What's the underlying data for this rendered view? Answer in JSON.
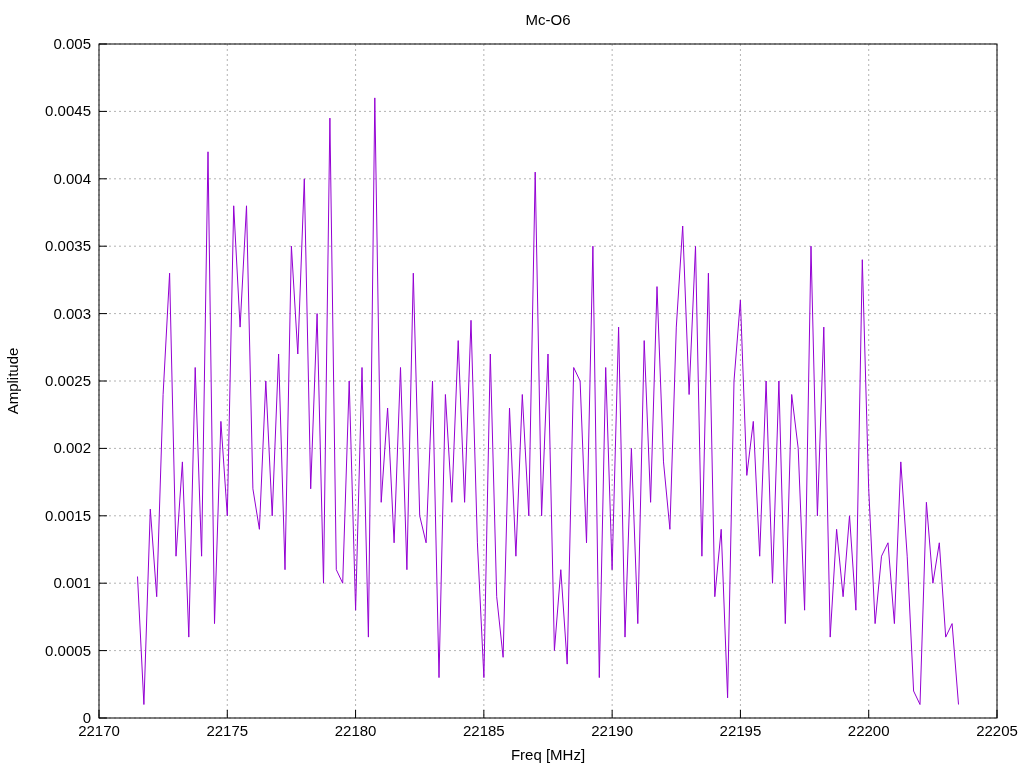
{
  "chart_data": {
    "type": "line",
    "title": "Mc-O6",
    "xlabel": "Freq [MHz]",
    "ylabel": "Amplitude",
    "xlim": [
      22170,
      22205
    ],
    "ylim": [
      0,
      0.005
    ],
    "xticks": [
      22170,
      22175,
      22180,
      22185,
      22190,
      22195,
      22200,
      22205
    ],
    "yticks": [
      0,
      0.0005,
      0.001,
      0.0015,
      0.002,
      0.0025,
      0.003,
      0.0035,
      0.004,
      0.0045,
      0.005
    ],
    "x": [
      22171.5,
      22171.75,
      22172,
      22172.25,
      22172.5,
      22172.75,
      22173,
      22173.25,
      22173.5,
      22173.75,
      22174,
      22174.25,
      22174.5,
      22174.75,
      22175,
      22175.25,
      22175.5,
      22175.75,
      22176,
      22176.25,
      22176.5,
      22176.75,
      22177,
      22177.25,
      22177.5,
      22177.75,
      22178,
      22178.25,
      22178.5,
      22178.75,
      22179,
      22179.25,
      22179.5,
      22179.75,
      22180,
      22180.25,
      22180.5,
      22180.75,
      22181,
      22181.25,
      22181.5,
      22181.75,
      22182,
      22182.25,
      22182.5,
      22182.75,
      22183,
      22183.25,
      22183.5,
      22183.75,
      22184,
      22184.25,
      22184.5,
      22184.75,
      22185,
      22185.25,
      22185.5,
      22185.75,
      22186,
      22186.25,
      22186.5,
      22186.75,
      22187,
      22187.25,
      22187.5,
      22187.75,
      22188,
      22188.25,
      22188.5,
      22188.75,
      22189,
      22189.25,
      22189.5,
      22189.75,
      22190,
      22190.25,
      22190.5,
      22190.75,
      22191,
      22191.25,
      22191.5,
      22191.75,
      22192,
      22192.25,
      22192.5,
      22192.75,
      22193,
      22193.25,
      22193.5,
      22193.75,
      22194,
      22194.25,
      22194.5,
      22194.75,
      22195,
      22195.25,
      22195.5,
      22195.75,
      22196,
      22196.25,
      22196.5,
      22196.75,
      22197,
      22197.25,
      22197.5,
      22197.75,
      22198,
      22198.25,
      22198.5,
      22198.75,
      22199,
      22199.25,
      22199.5,
      22199.75,
      22200,
      22200.25,
      22200.5,
      22200.75,
      22201,
      22201.25,
      22201.5,
      22201.75,
      22202,
      22202.25,
      22202.5,
      22202.75,
      22203,
      22203.25,
      22203.5
    ],
    "grid": true,
    "series": [
      {
        "color": "#9400d3",
        "values": [
          0.00105,
          0.0001,
          0.00155,
          0.0009,
          0.0024,
          0.0033,
          0.0012,
          0.0019,
          0.0006,
          0.0026,
          0.0012,
          0.0042,
          0.0007,
          0.0022,
          0.0015,
          0.0038,
          0.0029,
          0.0038,
          0.0017,
          0.0014,
          0.0025,
          0.0015,
          0.0027,
          0.0011,
          0.0035,
          0.0027,
          0.004,
          0.0017,
          0.003,
          0.001,
          0.00445,
          0.0011,
          0.001,
          0.0025,
          0.0008,
          0.0026,
          0.0006,
          0.0046,
          0.0016,
          0.0023,
          0.0013,
          0.0026,
          0.0011,
          0.0033,
          0.0015,
          0.0013,
          0.0025,
          0.0003,
          0.0024,
          0.0016,
          0.0028,
          0.0016,
          0.00295,
          0.0013,
          0.0003,
          0.0027,
          0.0009,
          0.00045,
          0.0023,
          0.0012,
          0.0024,
          0.0015,
          0.00405,
          0.0015,
          0.0027,
          0.0005,
          0.0011,
          0.0004,
          0.0026,
          0.0025,
          0.0013,
          0.0035,
          0.0003,
          0.0026,
          0.0011,
          0.0029,
          0.0006,
          0.002,
          0.0007,
          0.0028,
          0.0016,
          0.0032,
          0.0019,
          0.0014,
          0.0029,
          0.00365,
          0.0024,
          0.0035,
          0.0012,
          0.0033,
          0.0009,
          0.0014,
          0.00015,
          0.0025,
          0.0031,
          0.0018,
          0.0022,
          0.0012,
          0.0025,
          0.001,
          0.0025,
          0.0007,
          0.0024,
          0.002,
          0.0008,
          0.0035,
          0.0015,
          0.0029,
          0.0006,
          0.0014,
          0.0009,
          0.0015,
          0.0008,
          0.0034,
          0.0017,
          0.0007,
          0.0012,
          0.0013,
          0.0007,
          0.0019,
          0.0012,
          0.0002,
          0.0001,
          0.0016,
          0.001,
          0.0013,
          0.0006,
          0.0007,
          0.0001
        ]
      }
    ]
  }
}
